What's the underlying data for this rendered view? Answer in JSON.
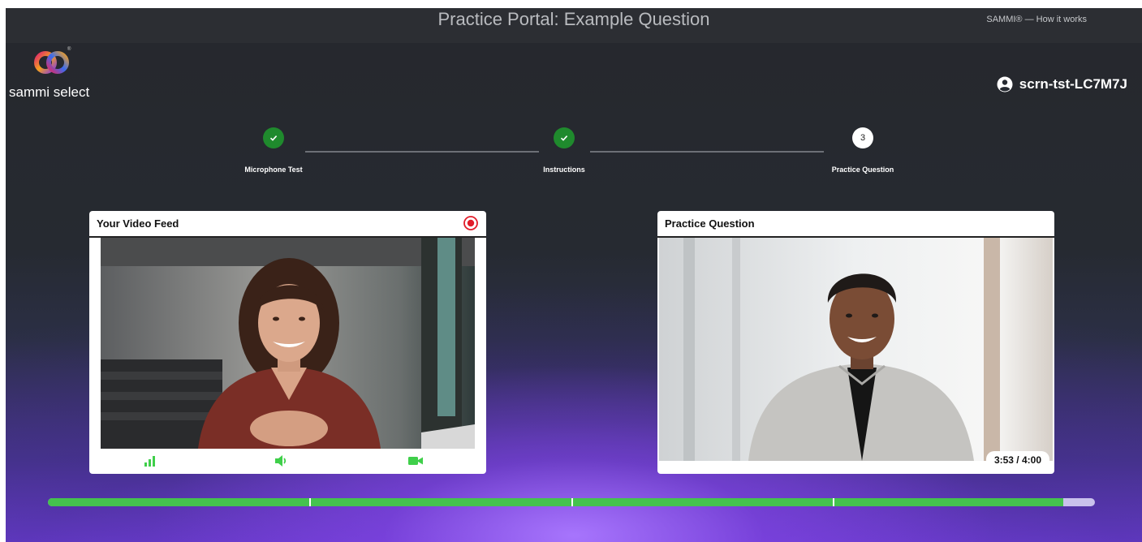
{
  "topbar": {
    "title": "Practice Portal: Example Question",
    "how_it_works": "SAMMI® — How it works"
  },
  "brand": {
    "name": "sammi select",
    "icon": "interlocking-rings-logo",
    "colors": [
      "#e0296a",
      "#f4a020",
      "#3a6cf0",
      "#8a3fd6"
    ]
  },
  "user": {
    "icon": "user-circle-icon",
    "id": "scrn-tst-LC7M7J"
  },
  "steps": [
    {
      "label": "Microphone Test",
      "status": "done",
      "icon": "check-icon"
    },
    {
      "label": "Instructions",
      "status": "done",
      "icon": "check-icon"
    },
    {
      "label": "Practice Question",
      "status": "current",
      "number": "3"
    }
  ],
  "video_panel": {
    "title": "Your Video Feed",
    "record_icon": "record-icon",
    "controls": [
      "signal-bars-icon",
      "speaker-icon",
      "camera-icon"
    ],
    "accent": "#3fcf4a"
  },
  "question_panel": {
    "title": "Practice Question",
    "timer": "3:53 / 4:00"
  },
  "progress": {
    "fraction_complete": 0.97,
    "segments": 4,
    "fill_color": "#45c24e"
  }
}
